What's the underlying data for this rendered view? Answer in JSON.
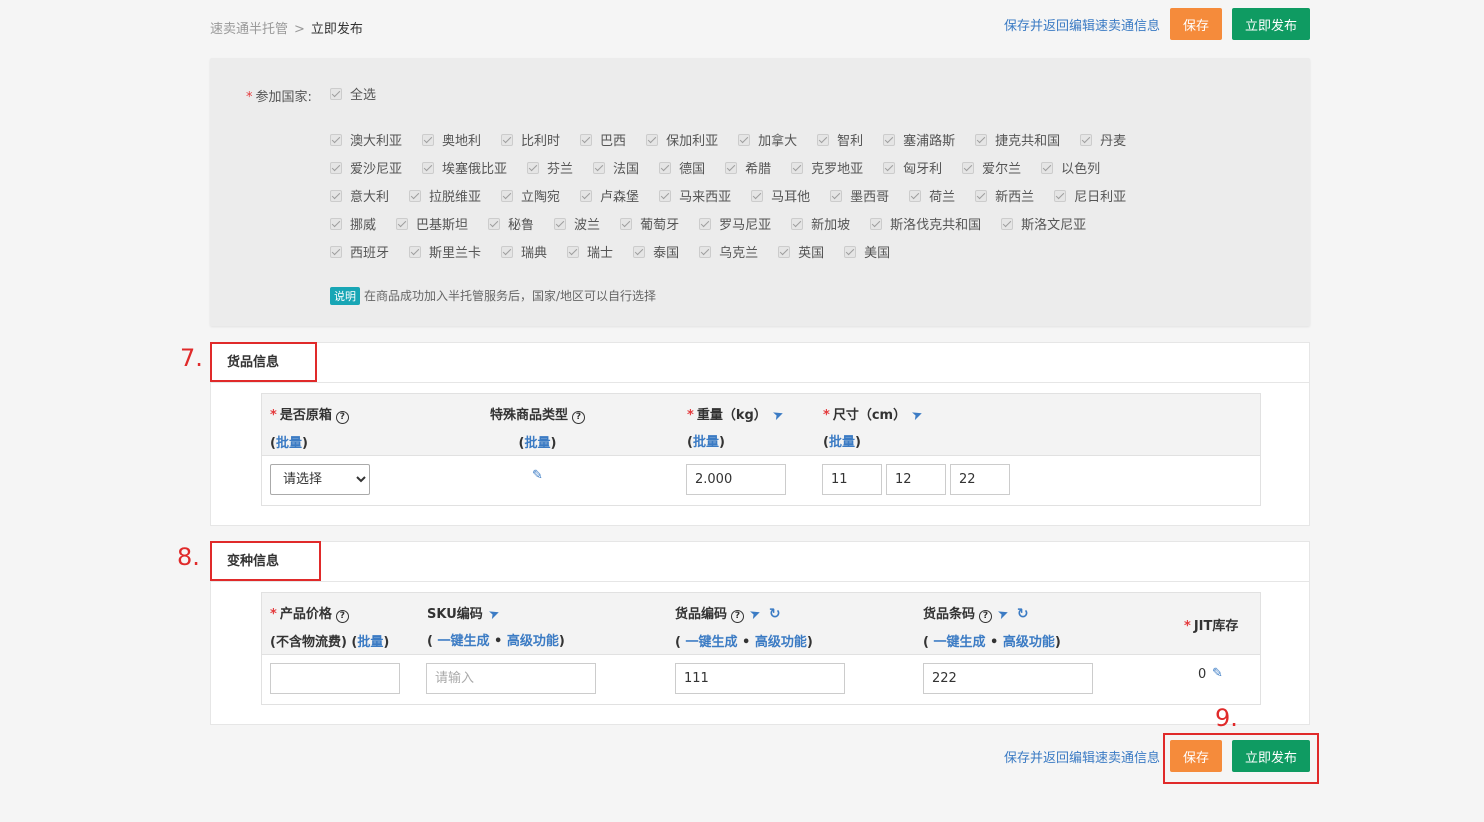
{
  "breadcrumb": {
    "parent": "速卖通半托管",
    "separator": ">",
    "current": "立即发布"
  },
  "actions": {
    "save_return": "保存并返回编辑速卖通信息",
    "save": "保存",
    "publish": "立即发布"
  },
  "countries": {
    "label": "参加国家:",
    "select_all": "全选",
    "rows": [
      [
        "澳大利亚",
        "奥地利",
        "比利时",
        "巴西",
        "保加利亚",
        "加拿大",
        "智利",
        "塞浦路斯",
        "捷克共和国",
        "丹麦"
      ],
      [
        "爱沙尼亚",
        "埃塞俄比亚",
        "芬兰",
        "法国",
        "德国",
        "希腊",
        "克罗地亚",
        "匈牙利",
        "爱尔兰",
        "以色列"
      ],
      [
        "意大利",
        "拉脱维亚",
        "立陶宛",
        "卢森堡",
        "马来西亚",
        "马耳他",
        "墨西哥",
        "荷兰",
        "新西兰",
        "尼日利亚"
      ],
      [
        "挪威",
        "巴基斯坦",
        "秘鲁",
        "波兰",
        "葡萄牙",
        "罗马尼亚",
        "新加坡",
        "斯洛伐克共和国",
        "斯洛文尼亚"
      ],
      [
        "西班牙",
        "斯里兰卡",
        "瑞典",
        "瑞士",
        "泰国",
        "乌克兰",
        "英国",
        "美国"
      ]
    ],
    "note_badge": "说明",
    "note_text": "在商品成功加入半托管服务后，国家/地区可以自行选择"
  },
  "goods": {
    "title": "货品信息",
    "marker": "7.",
    "col_original_box": "是否原箱",
    "col_special_type": "特殊商品类型",
    "col_weight": "重量（kg）",
    "col_size": "尺寸（cm）",
    "batch": "批量",
    "select_value": "请选择",
    "weight_value": "2.000",
    "size_l": "11",
    "size_w": "12",
    "size_h": "22"
  },
  "variant": {
    "title": "变种信息",
    "marker": "8.",
    "col_price": "产品价格",
    "col_price_sub": "(不含物流费)",
    "col_sku": "SKU编码",
    "col_goods_code": "货品编码",
    "col_barcode": "货品条码",
    "col_jit": "JIT库存",
    "batch": "批量",
    "one_click": "一键生成",
    "advanced": "高级功能",
    "dot": "•",
    "sku_placeholder": "请输入",
    "goods_code_value": "111",
    "barcode_value": "222",
    "jit_value": "0"
  },
  "bottom_marker": "9."
}
